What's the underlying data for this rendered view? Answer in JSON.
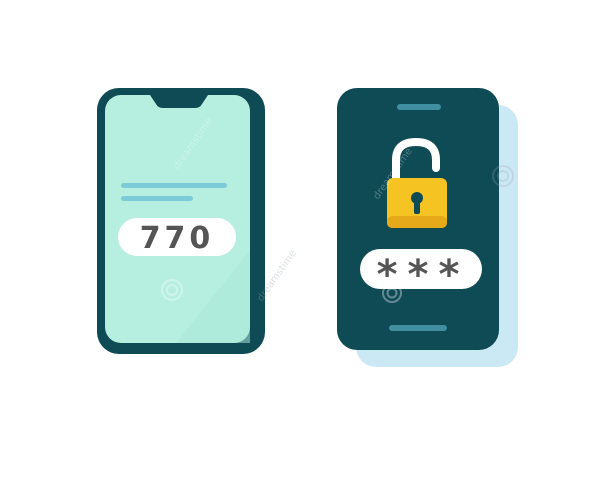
{
  "otp_phone": {
    "code": "770"
  },
  "lock_phone": {
    "password_mask": "***"
  },
  "watermark": {
    "text": "dreamstime"
  },
  "colors": {
    "phone_body": "#0f4b55",
    "screen_mint": "#b6efe0",
    "shadow_blue": "#cbe8f5",
    "lock_yellow": "#f5c422",
    "shackle_white": "#ffffff",
    "pill_white": "#ffffff",
    "code_text": "#555555"
  },
  "icons": [
    "smartphone-icon",
    "padlock-icon",
    "keyhole-icon"
  ]
}
